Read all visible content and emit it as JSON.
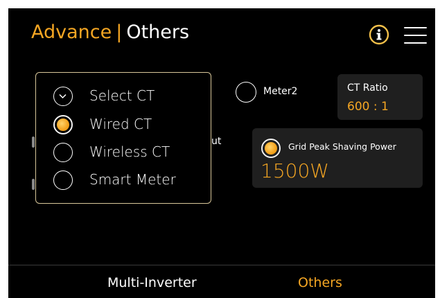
{
  "header": {
    "title_primary": "Advance",
    "title_separator": "|",
    "title_secondary": "Others",
    "info_icon": "info-circle-icon",
    "menu_icon": "hamburger-menu-icon"
  },
  "background": {
    "meter2_label": "Meter2",
    "partial_label": "ut"
  },
  "ct_ratio": {
    "label": "CT Ratio",
    "value": "600 : 1"
  },
  "grid_peak": {
    "label": "Grid Peak Shaving Power",
    "value": "1500W",
    "enabled": true
  },
  "ct_dropdown": {
    "header": "Select CT",
    "options": [
      {
        "label": "Wired CT",
        "selected": true
      },
      {
        "label": "Wireless CT",
        "selected": false
      },
      {
        "label": "Smart Meter",
        "selected": false
      }
    ]
  },
  "bottom_tabs": {
    "multi_inverter": "Multi-Inverter",
    "others": "Others",
    "active": "Others"
  },
  "colors": {
    "accent": "#f5a623",
    "background": "#000000",
    "panel": "#1f1f1f"
  }
}
